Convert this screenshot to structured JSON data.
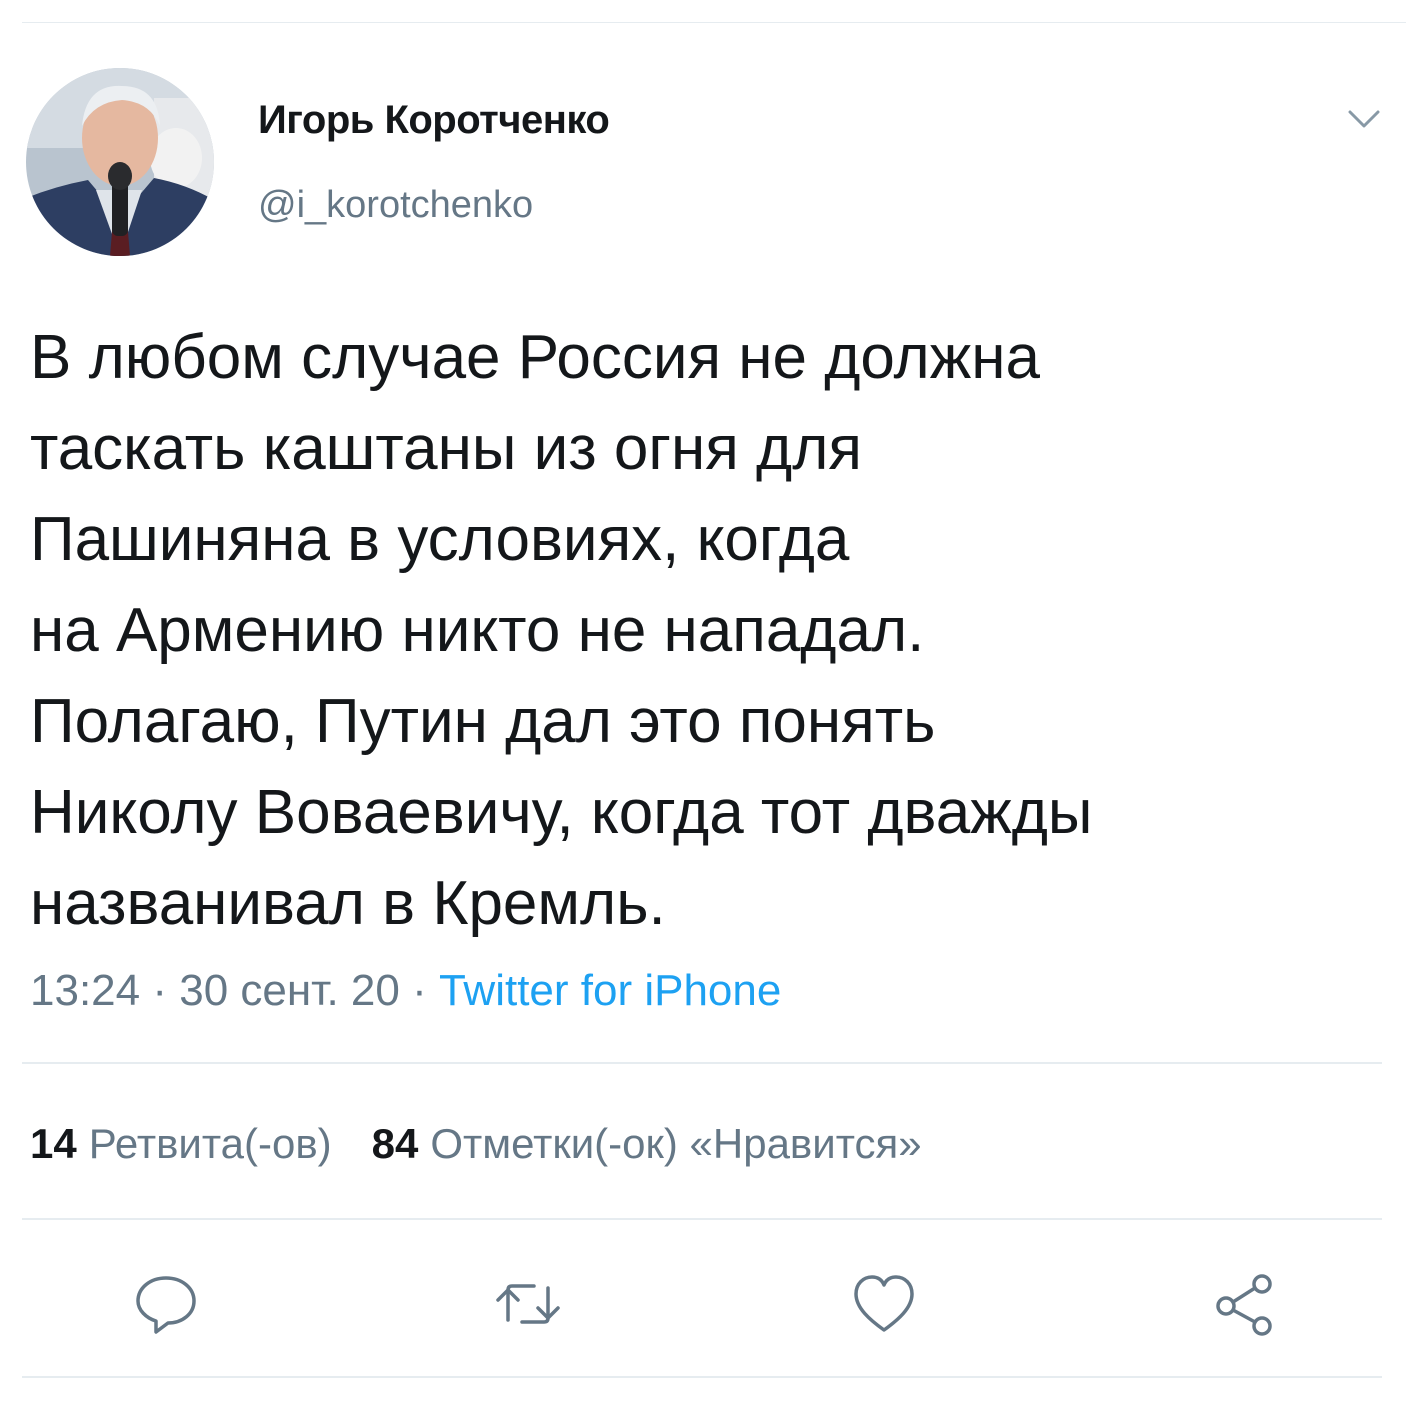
{
  "tweet": {
    "author": {
      "display_name": "Игорь Коротченко",
      "handle": "@i_korotchenko"
    },
    "text": "В любом случае Россия не должна\nтаскать каштаны из огня для\nПашиняна в условиях, когда\nна Армению никто не нападал.\nПолагаю, Путин дал это понять\nНиколу Воваевичу, когда тот дважды\nназванивал в Кремль.",
    "meta": {
      "time": "13:24",
      "separator": "·",
      "date": "30 сент. 20",
      "source": "Twitter for iPhone"
    },
    "stats": {
      "retweets_count": "14",
      "retweets_label": "Ретвита(-ов)",
      "likes_count": "84",
      "likes_label": "Отметки(-ок) «Нравится»"
    }
  },
  "icons": {
    "menu": "chevron-down-icon",
    "reply": "reply-icon",
    "retweet": "retweet-icon",
    "like": "heart-icon",
    "share": "share-icon"
  },
  "colors": {
    "text": "#14171a",
    "secondary": "#657786",
    "link": "#1da1f2",
    "divider": "#e6ecf0"
  }
}
